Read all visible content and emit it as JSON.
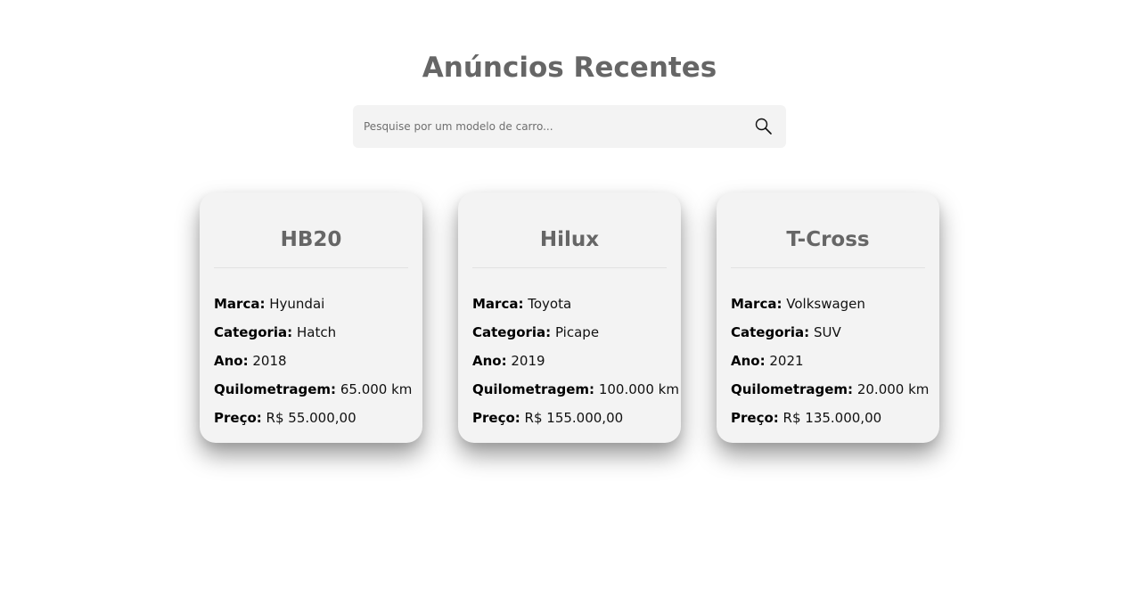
{
  "header": {
    "title": "Anúncios Recentes"
  },
  "search": {
    "placeholder": "Pesquise por um modelo de carro...",
    "value": "",
    "icon": "search-icon"
  },
  "labels": {
    "brand": "Marca:",
    "category": "Categoria:",
    "year": "Ano:",
    "mileage": "Quilometragem:",
    "price": "Preço:"
  },
  "cars": [
    {
      "model": "HB20",
      "brand": "Hyundai",
      "category": "Hatch",
      "year": "2018",
      "mileage": "65.000 km",
      "price": "R$ 55.000,00"
    },
    {
      "model": "Hilux",
      "brand": "Toyota",
      "category": "Picape",
      "year": "2019",
      "mileage": "100.000 km",
      "price": "R$ 155.000,00"
    },
    {
      "model": "T-Cross",
      "brand": "Volkswagen",
      "category": "SUV",
      "year": "2021",
      "mileage": "20.000 km",
      "price": "R$ 135.000,00"
    }
  ]
}
